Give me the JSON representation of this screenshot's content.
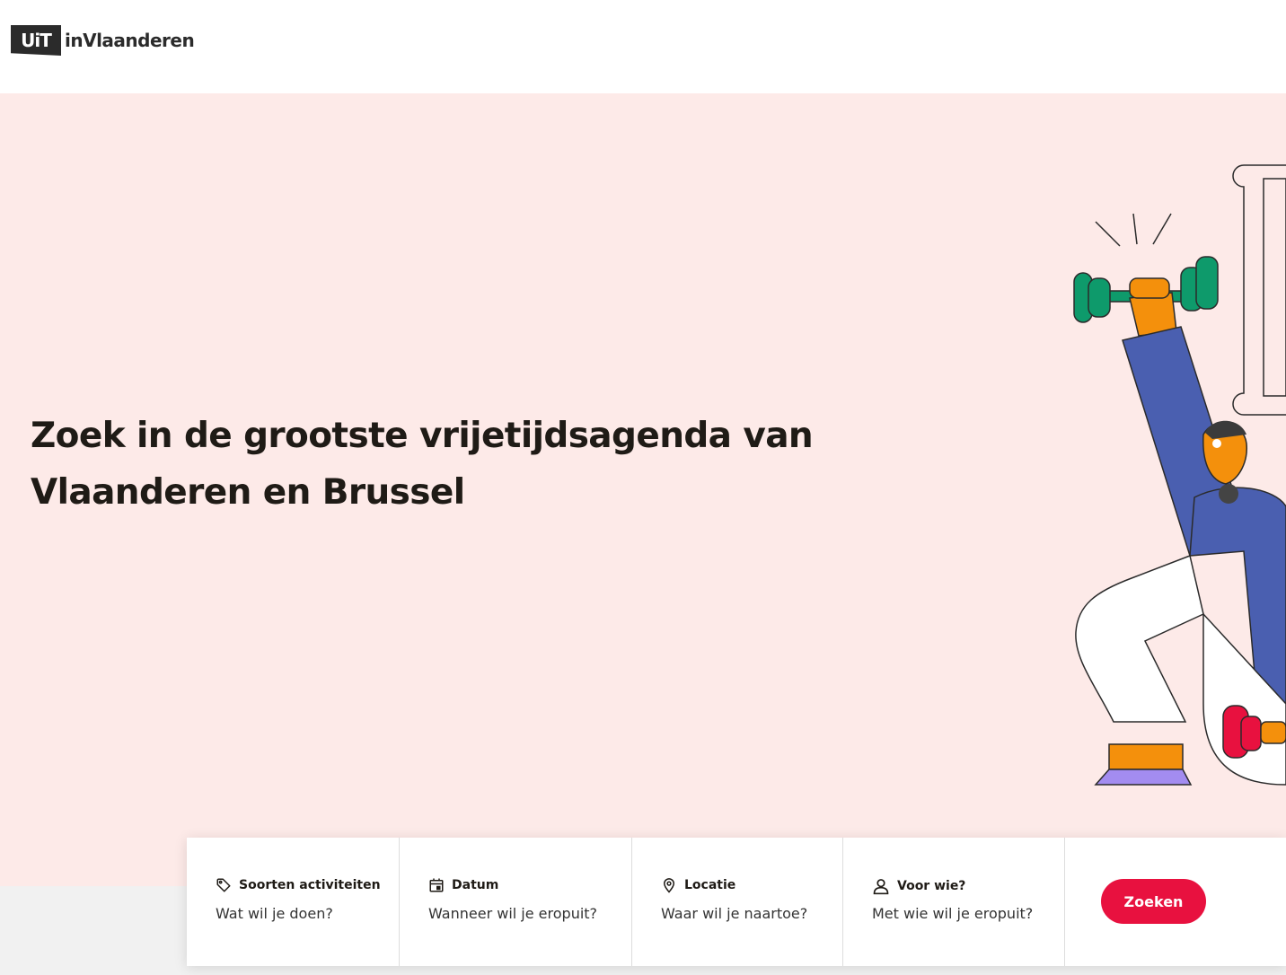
{
  "header": {
    "logo_box_text": "UiT",
    "logo_text": "inVlaanderen"
  },
  "hero": {
    "title": "Zoek in de grootste vrijetijdsagenda van Vlaanderen en Brussel"
  },
  "search": {
    "fields": [
      {
        "label": "Soorten activiteiten",
        "placeholder": "Wat wil je doen?",
        "icon": "tag-icon"
      },
      {
        "label": "Datum",
        "placeholder": "Wanneer wil je eropuit?",
        "icon": "calendar-icon"
      },
      {
        "label": "Locatie",
        "placeholder": "Waar wil je naartoe?",
        "icon": "location-pin-icon"
      },
      {
        "label": "Voor wie?",
        "placeholder": "Met wie wil je eropuit?",
        "icon": "person-icon"
      }
    ],
    "submit_label": "Zoeken"
  },
  "colors": {
    "hero_background": "#fdeae8",
    "accent": "#e8113f",
    "page_background": "#f1f1f1"
  }
}
